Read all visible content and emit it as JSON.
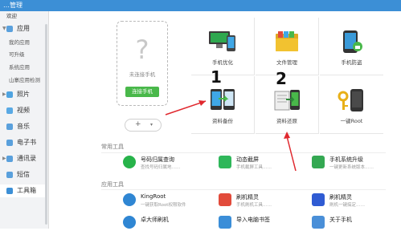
{
  "app": {
    "title_fragment": "…管理"
  },
  "sidebar": {
    "top_label": "欢迎",
    "items": [
      {
        "label": "应用",
        "sub": [
          "我的应用",
          "可升级",
          "系统应用",
          "山寨应用检测"
        ]
      },
      {
        "label": "照片"
      },
      {
        "label": "视频"
      },
      {
        "label": "音乐"
      },
      {
        "label": "电子书"
      },
      {
        "label": "通讯录"
      },
      {
        "label": "短信"
      },
      {
        "label": "工具箱"
      }
    ]
  },
  "phone_panel": {
    "placeholder_glyph": "?",
    "status": "未连接手机",
    "connect_button": "连接手机",
    "add_glyph": "+",
    "menu_glyph": "▾"
  },
  "grid": {
    "tiles": [
      {
        "label": "手机优化",
        "icon": "phone-optimize-icon"
      },
      {
        "label": "文件管理",
        "icon": "file-manager-icon"
      },
      {
        "label": "手机防盗",
        "icon": "anti-theft-icon"
      },
      {
        "label": "资料备份",
        "icon": "data-backup-icon"
      },
      {
        "label": "资料还原",
        "icon": "data-restore-icon"
      },
      {
        "label": "一键Root",
        "icon": "one-click-root-icon"
      }
    ]
  },
  "annotations": {
    "one": "1",
    "two": "2"
  },
  "common_tools": {
    "header": "常用工具",
    "items": [
      {
        "title": "号码归属查询",
        "desc": "查找号码归属地……",
        "color": "#27b34a",
        "icon": "phone-lookup-icon"
      },
      {
        "title": "动态截屏",
        "desc": "手机截屏工具……",
        "color": "#2fb75a",
        "icon": "screenshot-icon"
      },
      {
        "title": "手机系统升级",
        "desc": "一键更新系统版本……",
        "color": "#34a852",
        "icon": "system-upgrade-icon"
      }
    ]
  },
  "app_tools": {
    "header": "应用工具",
    "items": [
      {
        "title": "KingRoot",
        "desc": "一键获取Root权限软件",
        "color": "#2f86d3",
        "icon": "kingroot-icon"
      },
      {
        "title": "刷机精灵",
        "desc": "手机刷机工具……",
        "color": "#e24b3b",
        "icon": "flash-wizard-icon"
      },
      {
        "title": "刷机精灵",
        "desc": "刷机一键搞定……",
        "color": "#2f5bd3",
        "icon": "flash-master-icon"
      },
      {
        "title": "卓大师刷机",
        "desc": "",
        "color": "#2f86d3",
        "icon": "zhuo-master-icon"
      },
      {
        "title": "导入电脑书签",
        "desc": "",
        "color": "#3b8ed8",
        "icon": "import-bookmark-icon"
      },
      {
        "title": "关于手机",
        "desc": "",
        "color": "#4a8fd8",
        "icon": "about-phone-icon"
      }
    ]
  },
  "colors": {
    "accent": "#3c8fd6",
    "green": "#49b84a",
    "arrow": "#e0282e"
  }
}
